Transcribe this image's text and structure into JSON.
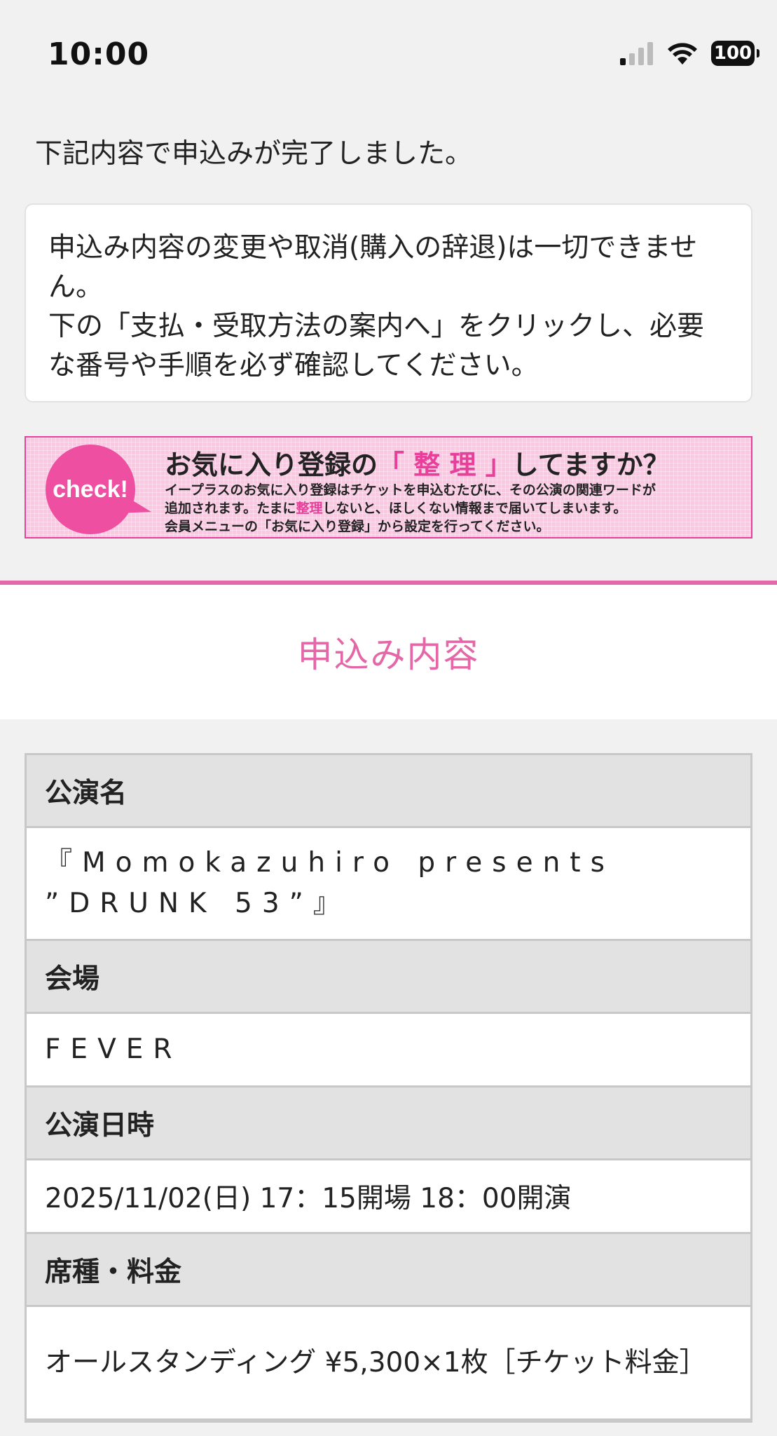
{
  "status_bar": {
    "time": "10:00",
    "battery": "100"
  },
  "complete_message": "下記内容で申込みが完了しました。",
  "notice": {
    "line1": "申込み内容の変更や取消(購入の辞退)は一切できません。",
    "line2": "下の「支払・受取方法の案内へ」をクリックし、必要な番号や手順を必ず確認してください。"
  },
  "banner": {
    "badge": "check!",
    "title_pre": "お気に入り登録の",
    "title_hl": "「 整 理 」",
    "title_post": "してますか？",
    "body_line1": "イープラスのお気に入り登録はチケットを申込むたびに、その公演の関連ワードが",
    "body_line2_pre": "追加されます。たまに",
    "body_line2_hl": "整理",
    "body_line2_post": "しないと、ほしくない情報まで届いてしまいます。",
    "body_line3": "会員メニューの「お気に入り登録」から設定を行ってください。"
  },
  "section_title": "申込み内容",
  "details": {
    "performance_label": "公演名",
    "performance_value": "『Momokazuhiro presents ”DRUNK 53”』",
    "venue_label": "会場",
    "venue_value": "FEVER",
    "datetime_label": "公演日時",
    "datetime_value": "2025/11/02(日) 17：15開場 18：00開演",
    "seat_label": "席種・料金",
    "seat_value": "オールスタンディング ¥5,300×1枚［チケット料金］"
  },
  "colors": {
    "accent": "#e467a7",
    "banner_pink": "#ee4fa1",
    "background": "#f1f1f1"
  }
}
